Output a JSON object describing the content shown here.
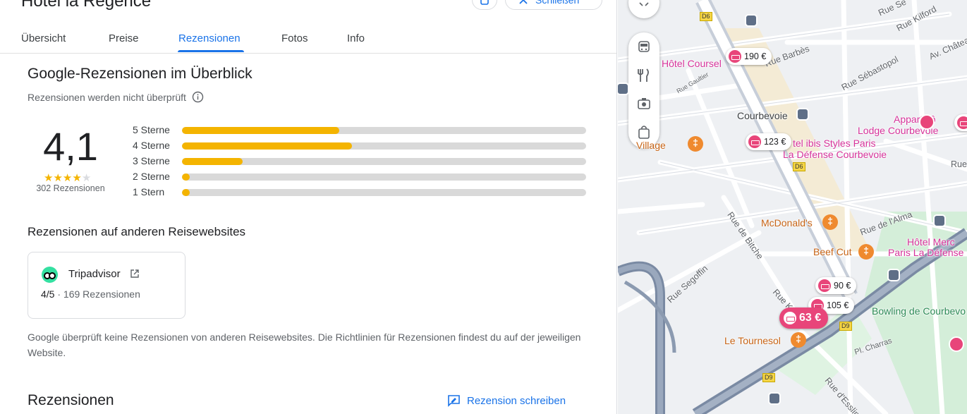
{
  "header": {
    "hotel_name": "Hôtel la Régence",
    "share_label": "Schließen"
  },
  "tabs": [
    {
      "label": "Übersicht"
    },
    {
      "label": "Preise"
    },
    {
      "label": "Rezensionen",
      "active": true
    },
    {
      "label": "Fotos"
    },
    {
      "label": "Info"
    }
  ],
  "overview": {
    "heading": "Google-Rezensionen im Überblick",
    "note": "Rezensionen werden nicht überprüft",
    "rating": "4,1",
    "stars_filled": 4,
    "stars_total": 5,
    "review_count": "302 Rezensionen",
    "accent_color": "#f4b400",
    "distribution": [
      {
        "label": "5 Sterne",
        "fraction": 0.39
      },
      {
        "label": "4 Sterne",
        "fraction": 0.42
      },
      {
        "label": "3 Sterne",
        "fraction": 0.15
      },
      {
        "label": "2 Sterne",
        "fraction": 0.02
      },
      {
        "label": "1 Stern",
        "fraction": 0.02
      }
    ]
  },
  "other_sites": {
    "heading": "Rezensionen auf anderen Reisewebsites",
    "site_name": "Tripadvisor",
    "score": "4/5",
    "score_detail": "· 169 Rezensionen",
    "disclaimer": "Google überprüft keine Rezensionen von anderen Reisewebsites. Die Richtlinien für Rezensionen findest du auf der jeweiligen Website."
  },
  "reviews": {
    "heading": "Rezensionen",
    "write_label": "Rezension schreiben"
  },
  "map": {
    "controls": [
      "transit-icon",
      "restaurant-icon",
      "attraction-icon",
      "shopping-icon"
    ],
    "price_pins": [
      {
        "price": "190 €"
      },
      {
        "price": "123 €"
      },
      {
        "price": "90 €"
      },
      {
        "price": "105 €"
      },
      {
        "price": "63 €",
        "selected": true
      }
    ],
    "poi_labels": {
      "hotel_coursel": "Hôtel Coursel",
      "courbevoie": "Courbevoie",
      "appart": "Appart'hô",
      "lodge": "Lodge Courbevoie",
      "ibis1": "tel ibis Styles Paris",
      "ibis2": "La Défense Courbevoie",
      "village": "Village",
      "mcdonalds": "McDonald's",
      "beefcut": "Beef Cut",
      "mercure1": "Hôtel Merc",
      "mercure2": "Paris La Défense",
      "bowling": "Bowling de Courbevo",
      "tournesol": "Le Tournesol",
      "ninety": "90"
    },
    "street_labels": {
      "barbes": "Rue Barbès",
      "sebastopol": "Rue Sébastopol",
      "kilford": "Rue Kilford",
      "rue_se": "Rue Se",
      "chateau": "Av. Châtea",
      "gaultier": "Rue Gaultier",
      "bitche": "Rue de Bitche",
      "alma": "Rue de l'Alma",
      "segoffin": "Rue Segoffin",
      "charras": "Pl. Charras",
      "esslin": "Rue d'Esslin",
      "rue_k": "Rue K",
      "rue_right": "Rue"
    },
    "road_signs": {
      "d6a": "D6",
      "d6b": "D6",
      "d9a": "D9",
      "d9b": "D9"
    }
  }
}
